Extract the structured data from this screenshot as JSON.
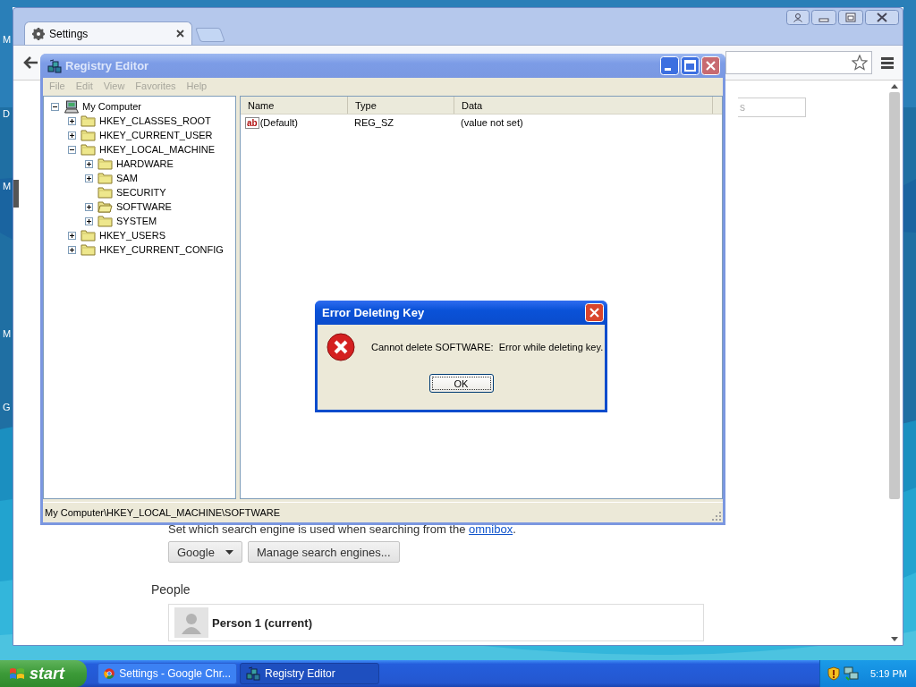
{
  "desktop": {
    "icon_labels": [
      "M",
      "D",
      "M",
      "M",
      "G"
    ]
  },
  "browser": {
    "tab": {
      "title": "Settings"
    },
    "search_field": {
      "placeholder": "s"
    },
    "search_engine": {
      "description": "Set which search engine is used when searching from the ",
      "link": "omnibox",
      "end": ".",
      "engine": "Google",
      "manage_button": "Manage search engines..."
    },
    "people": {
      "heading": "People",
      "profiles": [
        {
          "name": "Person 1 (current)"
        }
      ]
    }
  },
  "registry_editor": {
    "title": "Registry Editor",
    "menu": [
      {
        "label": "File",
        "disabled": true
      },
      {
        "label": "Edit",
        "disabled": true
      },
      {
        "label": "View",
        "disabled": true
      },
      {
        "label": "Favorites",
        "disabled": true
      },
      {
        "label": "Help",
        "disabled": true
      }
    ],
    "tree": [
      {
        "label": "My Computer",
        "kind": "computer",
        "expandable": true,
        "expanded": true,
        "children": [
          {
            "label": "HKEY_CLASSES_ROOT",
            "kind": "folder",
            "expandable": true,
            "expanded": false
          },
          {
            "label": "HKEY_CURRENT_USER",
            "kind": "folder",
            "expandable": true,
            "expanded": false
          },
          {
            "label": "HKEY_LOCAL_MACHINE",
            "kind": "folder",
            "expandable": true,
            "expanded": true,
            "children": [
              {
                "label": "HARDWARE",
                "kind": "folder",
                "expandable": true,
                "expanded": false
              },
              {
                "label": "SAM",
                "kind": "folder",
                "expandable": true,
                "expanded": false
              },
              {
                "label": "SECURITY",
                "kind": "folder",
                "expandable": false,
                "expanded": false
              },
              {
                "label": "SOFTWARE",
                "kind": "open-folder",
                "expandable": true,
                "expanded": false
              },
              {
                "label": "SYSTEM",
                "kind": "folder",
                "expandable": true,
                "expanded": false
              }
            ]
          },
          {
            "label": "HKEY_USERS",
            "kind": "folder",
            "expandable": true,
            "expanded": false
          },
          {
            "label": "HKEY_CURRENT_CONFIG",
            "kind": "folder",
            "expandable": true,
            "expanded": false
          }
        ]
      }
    ],
    "columns": [
      "Name",
      "Type",
      "Data"
    ],
    "rows": [
      {
        "badge": "ab",
        "name": "(Default)",
        "type": "REG_SZ",
        "data": "(value not set)"
      }
    ],
    "status": "My Computer\\HKEY_LOCAL_MACHINE\\SOFTWARE"
  },
  "dialog": {
    "title": "Error Deleting Key",
    "message": "Cannot delete SOFTWARE:  Error while deleting key.",
    "button": "OK"
  },
  "taskbar": {
    "start": "start",
    "tasks": [
      {
        "label": "Settings - Google Chr...",
        "kind": "browser",
        "selected": false
      },
      {
        "label": "Registry Editor",
        "kind": "registry",
        "selected": true
      }
    ],
    "clock": "5:19 PM"
  }
}
